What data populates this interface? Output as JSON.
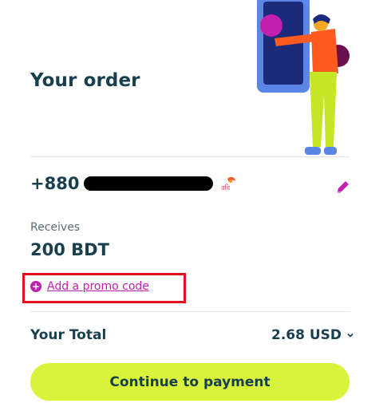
{
  "order": {
    "title": "Your order",
    "phone_prefix": "+880",
    "receives_label": "Receives",
    "receives_value": "200 BDT",
    "promo_link": "Add a promo code",
    "total_label": "Your Total",
    "total_value": "2.68 USD",
    "cta_label": "Continue to payment"
  },
  "colors": {
    "accent_lime": "#d9f23a",
    "promo_magenta": "#c21fae",
    "text_dark": "#173f4e",
    "highlight_red": "#e0121c"
  },
  "icons": {
    "edit": "pencil-icon",
    "promo": "plus-circle-icon",
    "total_toggle": "chevron-down-icon",
    "operator": "robi-operator-logo"
  }
}
